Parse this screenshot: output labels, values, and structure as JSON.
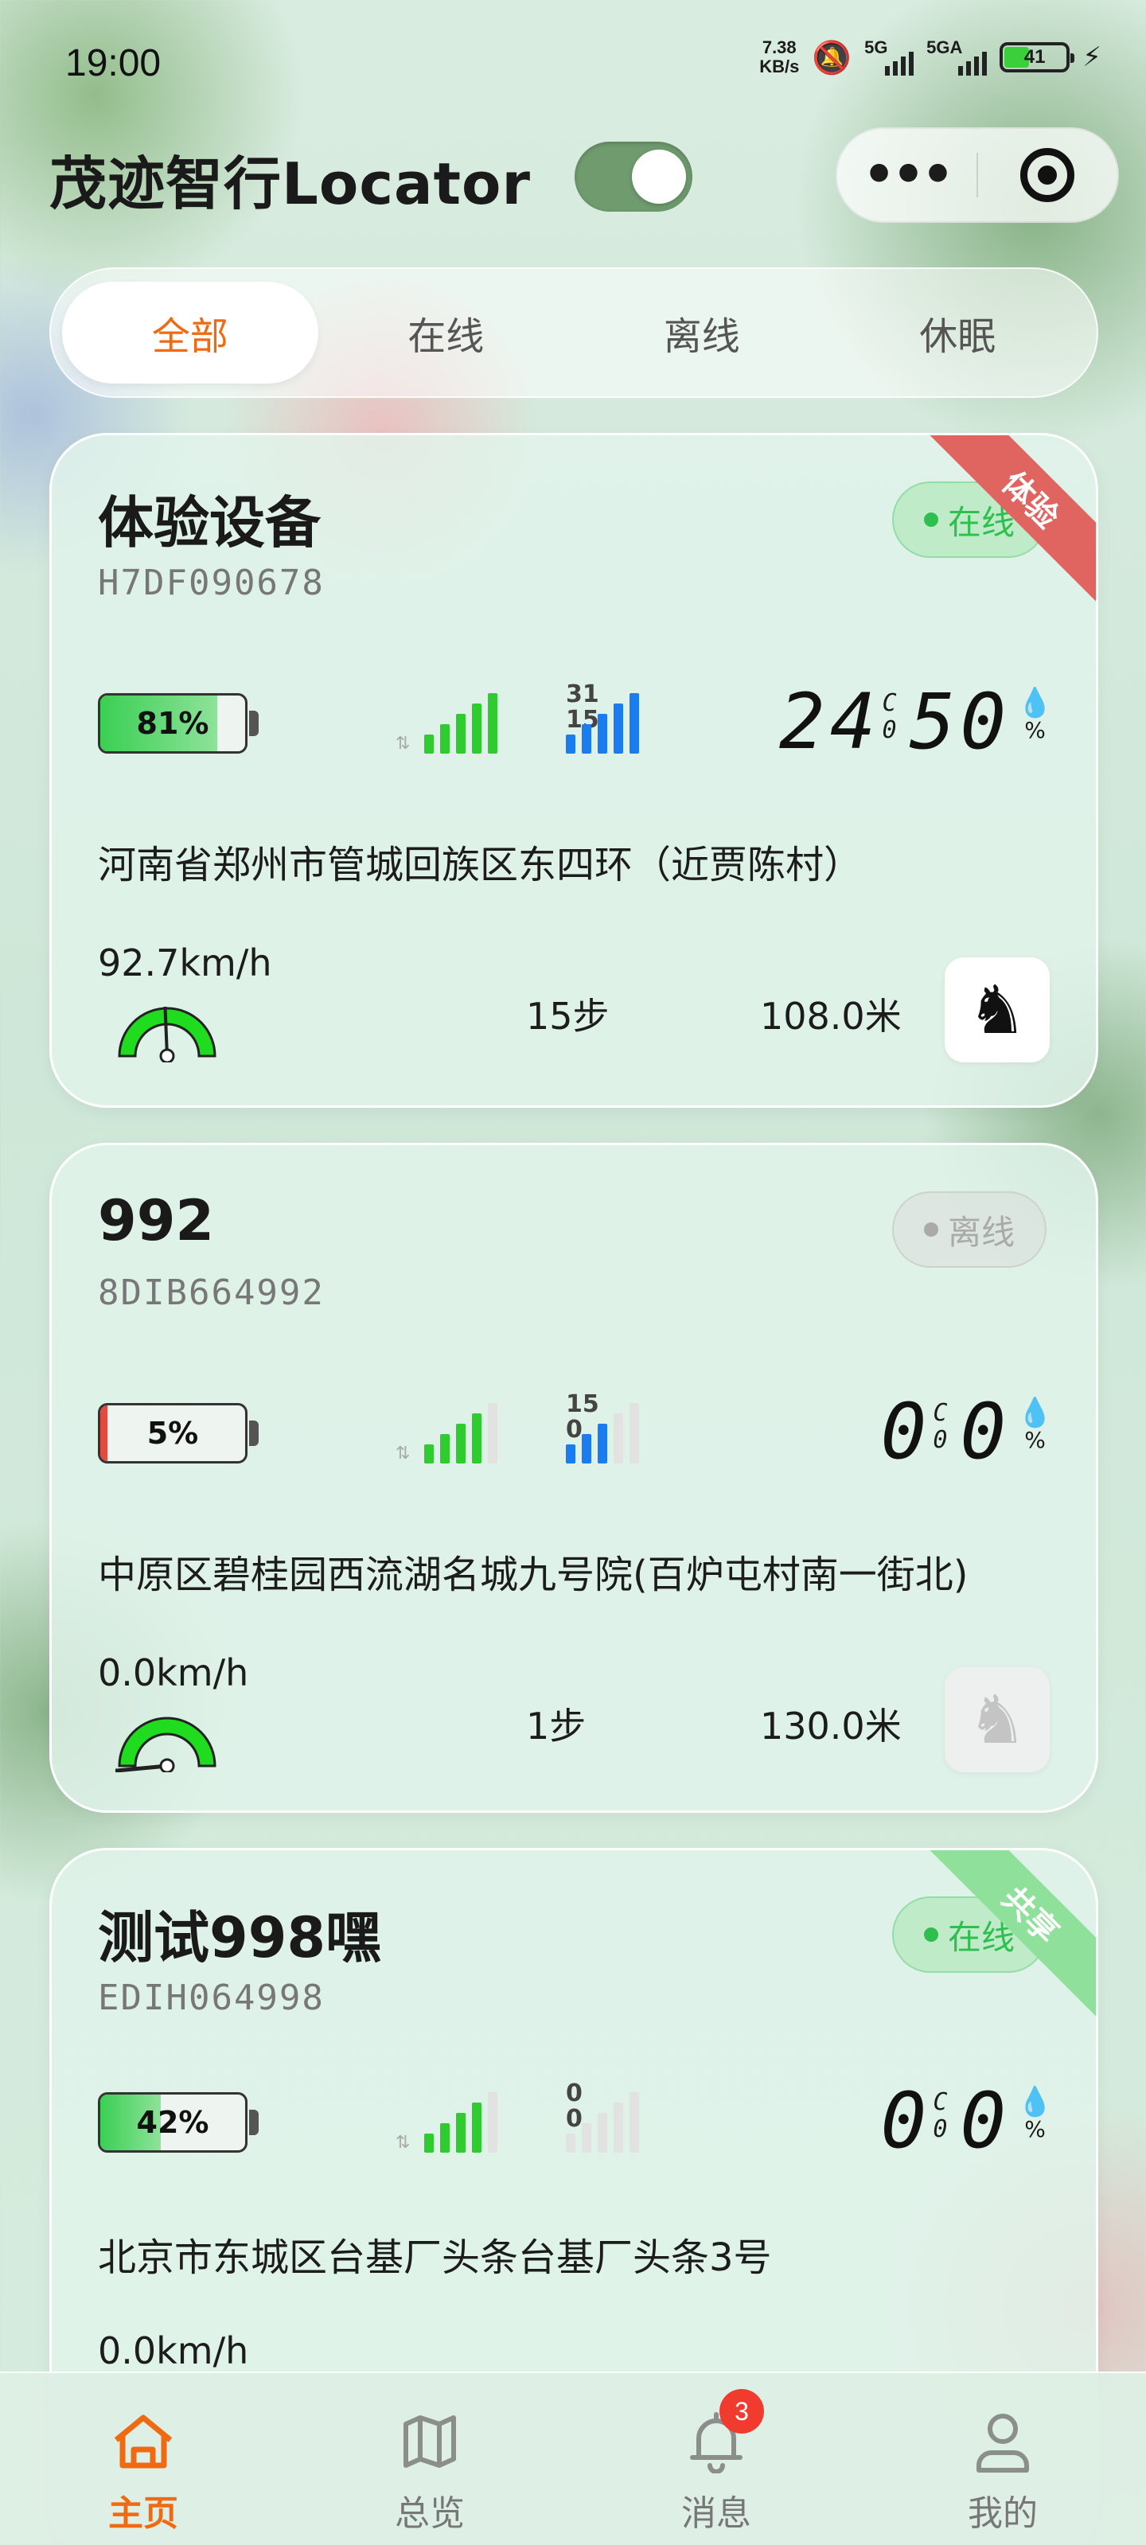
{
  "status_bar": {
    "time": "19:00",
    "net_speed_value": "7.38",
    "net_speed_unit": "KB/s",
    "sim1_label": "5G",
    "sim2_label": "5GA",
    "battery": "41"
  },
  "header": {
    "title": "茂迹智行Locator",
    "toggle_on": true,
    "more_icon": "ellipsis-icon",
    "target_icon": "target-icon"
  },
  "tabs": [
    {
      "label": "全部",
      "active": true
    },
    {
      "label": "在线",
      "active": false
    },
    {
      "label": "离线",
      "active": false
    },
    {
      "label": "休眠",
      "active": false
    }
  ],
  "devices": [
    {
      "name": "体验设备",
      "id": "H7DF090678",
      "status": "在线",
      "ribbon": "体验",
      "battery": "81%",
      "battery_level": 0.81,
      "signal_level": 5,
      "net_top": "31",
      "net_bottom": "15",
      "net_level": 5,
      "temp": "24",
      "temp_small_top": "C",
      "temp_small_bottom": "0",
      "humidity": "50",
      "humidity_unit": "%",
      "address": "河南省郑州市管城回族区东四环（近贾陈村）",
      "speed": "92.7km/h",
      "steps": "15步",
      "distance": "108.0米"
    },
    {
      "name": "992",
      "id": "8DIB664992",
      "status": "离线",
      "battery": "5%",
      "battery_level": 0.05,
      "signal_level": 4,
      "net_top": "15",
      "net_bottom": "0",
      "net_level": 3,
      "temp": "0",
      "temp_small_top": "C",
      "temp_small_bottom": "0",
      "humidity": "0",
      "humidity_unit": "%",
      "address": "中原区碧桂园西流湖名城九号院(百炉屯村南一街北)",
      "speed": "0.0km/h",
      "steps": "1步",
      "distance": "130.0米"
    },
    {
      "name": "测试998嘿",
      "id": "EDIH064998",
      "status": "在线",
      "ribbon": "共享",
      "battery": "42%",
      "battery_level": 0.42,
      "signal_level": 4,
      "net_top": "0",
      "net_bottom": "0",
      "net_level": 0,
      "temp": "0",
      "temp_small_top": "C",
      "temp_small_bottom": "0",
      "humidity": "0",
      "humidity_unit": "%",
      "address": "北京市东城区台基厂头条台基厂头条3号",
      "speed": "0.0km/h"
    }
  ],
  "bottom_nav": [
    {
      "label": "主页",
      "icon": "home-icon",
      "active": true
    },
    {
      "label": "总览",
      "icon": "map-icon",
      "active": false
    },
    {
      "label": "消息",
      "icon": "bell-icon",
      "active": false,
      "badge": "3"
    },
    {
      "label": "我的",
      "icon": "user-icon",
      "active": false
    }
  ],
  "colors": {
    "accent": "#f06a12",
    "online": "#2fbf4f",
    "offline": "#aaaaaa",
    "signal": "#2ecc2e",
    "network": "#1a7cf0",
    "ribbon_trial": "#e0645f",
    "ribbon_share": "#8ee09a"
  }
}
